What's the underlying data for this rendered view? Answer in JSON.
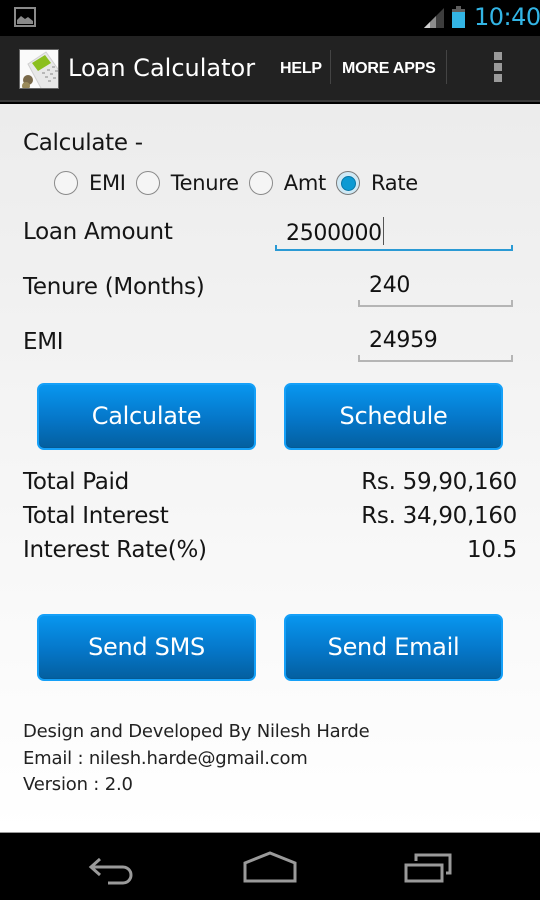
{
  "status_bar": {
    "time": "10:40",
    "icons": [
      "notification-image-icon",
      "signal-icon",
      "battery-icon"
    ],
    "accent_color": "#33b5e5"
  },
  "action_bar": {
    "title": "Loan Calculator",
    "actions": [
      {
        "label": "HELP"
      },
      {
        "label": "MORE APPS"
      }
    ],
    "overflow_icon": "overflow-menu-icon"
  },
  "form": {
    "calculate_label": "Calculate -",
    "radio_options": [
      {
        "label": "EMI",
        "checked": false
      },
      {
        "label": "Tenure",
        "checked": false
      },
      {
        "label": "Amt",
        "checked": false
      },
      {
        "label": "Rate",
        "checked": true
      }
    ],
    "fields": {
      "loan_amount": {
        "label": "Loan Amount",
        "value": "2500000",
        "focused": true
      },
      "tenure": {
        "label": "Tenure (Months)",
        "value": "240"
      },
      "emi": {
        "label": "EMI",
        "value": "24959"
      }
    },
    "buttons": {
      "calculate": "Calculate",
      "schedule": "Schedule",
      "send_sms": "Send SMS",
      "send_email": "Send Email"
    },
    "button_color": "#0576c8"
  },
  "results": [
    {
      "label": "Total Paid",
      "value": "Rs. 59,90,160"
    },
    {
      "label": "Total Interest",
      "value": "Rs. 34,90,160"
    },
    {
      "label": "Interest Rate(%)",
      "value": "10.5"
    }
  ],
  "footer": {
    "credit": "Design and Developed By Nilesh Harde",
    "email": "Email : nilesh.harde@gmail.com",
    "version": "Version : 2.0"
  },
  "nav_bar": {
    "buttons": [
      "back-icon",
      "home-icon",
      "recent-apps-icon"
    ]
  }
}
